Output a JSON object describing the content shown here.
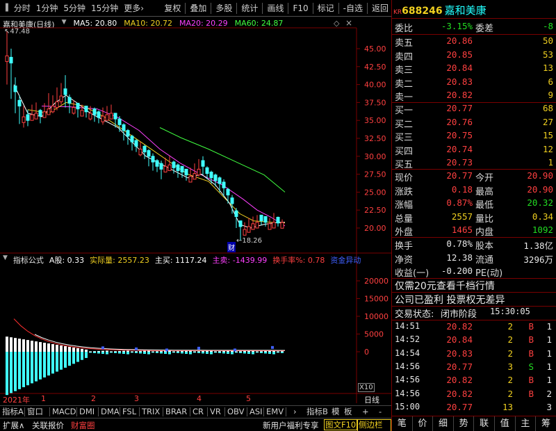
{
  "toolbar": {
    "left_items": [
      "分时",
      "1分钟",
      "5分钟",
      "15分钟",
      "更多"
    ],
    "more_arrow": "›",
    "right_items": [
      "复权",
      "叠加",
      "多股",
      "统计",
      "画线",
      "F10",
      "标记",
      "-自选",
      "返回"
    ]
  },
  "main_chart": {
    "title": "嘉和美康(日线)",
    "ma": [
      {
        "label": "MA5: 20.80",
        "color": "#ffffff"
      },
      {
        "label": "MA10: 20.72",
        "color": "#f0d020"
      },
      {
        "label": "MA20: 20.29",
        "color": "#ff40ff"
      },
      {
        "label": "MA60: 24.87",
        "color": "#40ff40"
      }
    ],
    "high_label": "47.48",
    "low_label": "18.26",
    "marker": "财",
    "y_ticks": [
      "45.00",
      "42.50",
      "40.00",
      "37.50",
      "35.00",
      "32.50",
      "30.00",
      "27.50",
      "25.00",
      "22.50",
      "20.00"
    ]
  },
  "chart_data": {
    "type": "candlestick",
    "ylim": [
      18,
      48
    ],
    "ma60_points": [
      [
        230,
        34.0
      ],
      [
        260,
        32.6
      ],
      [
        300,
        31.0
      ],
      [
        340,
        29.2
      ],
      [
        380,
        27.4
      ],
      [
        410,
        25.0
      ]
    ],
    "ma20_points": [
      [
        60,
        37.0
      ],
      [
        100,
        36.9
      ],
      [
        140,
        36.6
      ],
      [
        170,
        35.4
      ],
      [
        200,
        33.6
      ],
      [
        230,
        31.0
      ],
      [
        260,
        29.0
      ],
      [
        290,
        27.4
      ],
      [
        320,
        26.0
      ],
      [
        350,
        24.0
      ],
      [
        370,
        22.5
      ],
      [
        390,
        21.5
      ],
      [
        410,
        20.3
      ]
    ],
    "ma10_points": [
      [
        40,
        36.5
      ],
      [
        70,
        36.0
      ],
      [
        95,
        37.5
      ],
      [
        120,
        37.0
      ],
      [
        150,
        35.5
      ],
      [
        180,
        33.5
      ],
      [
        210,
        31.5
      ],
      [
        240,
        29.5
      ],
      [
        270,
        27.5
      ],
      [
        300,
        26.5
      ],
      [
        325,
        24.0
      ],
      [
        345,
        22.0
      ],
      [
        365,
        21.0
      ],
      [
        390,
        20.8
      ],
      [
        410,
        20.72
      ]
    ],
    "ma5_points": [
      [
        20,
        40.0
      ],
      [
        40,
        36.0
      ],
      [
        60,
        35.5
      ],
      [
        80,
        37.5
      ],
      [
        95,
        38.5
      ],
      [
        110,
        37.5
      ],
      [
        130,
        36.0
      ],
      [
        150,
        35.0
      ],
      [
        170,
        34.0
      ],
      [
        190,
        32.0
      ],
      [
        210,
        30.0
      ],
      [
        230,
        29.0
      ],
      [
        250,
        28.0
      ],
      [
        270,
        27.0
      ],
      [
        290,
        27.5
      ],
      [
        310,
        26.0
      ],
      [
        330,
        23.5
      ],
      [
        345,
        20.5
      ],
      [
        360,
        20.0
      ],
      [
        380,
        20.5
      ],
      [
        400,
        20.8
      ],
      [
        410,
        20.8
      ]
    ],
    "candles": [
      [
        10,
        44,
        47.48,
        40,
        "r"
      ],
      [
        16,
        43,
        45,
        38,
        "g"
      ],
      [
        22,
        39,
        41,
        36,
        "g"
      ],
      [
        28,
        37,
        38.5,
        34.5,
        "g"
      ],
      [
        34,
        35.5,
        37,
        34,
        "r"
      ],
      [
        40,
        35,
        36.5,
        34.2,
        "g"
      ],
      [
        46,
        35.8,
        37.2,
        35,
        "r"
      ],
      [
        52,
        36,
        37.5,
        35.2,
        "r"
      ],
      [
        58,
        35.6,
        36.6,
        34.6,
        "g"
      ],
      [
        64,
        36.2,
        37.4,
        35.4,
        "r"
      ],
      [
        70,
        36.6,
        38.8,
        35.8,
        "r"
      ],
      [
        76,
        37,
        38.5,
        36,
        "r"
      ],
      [
        82,
        37.6,
        39.6,
        36.4,
        "r"
      ],
      [
        88,
        38.4,
        40.2,
        37.2,
        "r"
      ],
      [
        94,
        38.6,
        41.3,
        36.8,
        "g"
      ],
      [
        100,
        37.4,
        38.6,
        36,
        "g"
      ],
      [
        106,
        36.8,
        37.8,
        35.8,
        "r"
      ],
      [
        112,
        36.6,
        37.4,
        35.4,
        "g"
      ],
      [
        118,
        36.4,
        37.2,
        35.6,
        "r"
      ],
      [
        124,
        36.2,
        37,
        35.4,
        "g"
      ],
      [
        130,
        36,
        37,
        35,
        "r"
      ],
      [
        136,
        35.8,
        36.8,
        34.8,
        "g"
      ],
      [
        142,
        35.4,
        36.4,
        34.6,
        "g"
      ],
      [
        148,
        35.6,
        36.8,
        34.4,
        "r"
      ],
      [
        154,
        35.8,
        37,
        35,
        "r"
      ],
      [
        160,
        36,
        37.2,
        35.2,
        "r"
      ],
      [
        166,
        35.2,
        36,
        34,
        "g"
      ],
      [
        172,
        34.4,
        35.6,
        33.4,
        "g"
      ],
      [
        178,
        33.6,
        34.6,
        32.2,
        "g"
      ],
      [
        184,
        32.8,
        33.8,
        31.6,
        "g"
      ],
      [
        190,
        32,
        33,
        30.8,
        "g"
      ],
      [
        196,
        31.4,
        32.4,
        30.6,
        "g"
      ],
      [
        202,
        31,
        32,
        30,
        "r"
      ],
      [
        208,
        30.6,
        31.6,
        29.6,
        "g"
      ],
      [
        214,
        30,
        31,
        28.6,
        "g"
      ],
      [
        220,
        29.2,
        30.4,
        28,
        "g"
      ],
      [
        226,
        28.6,
        29.6,
        27.8,
        "g"
      ],
      [
        232,
        28.2,
        29.4,
        26.8,
        "g"
      ],
      [
        238,
        28.6,
        29.8,
        27.8,
        "r"
      ],
      [
        244,
        28.8,
        30,
        28,
        "r"
      ],
      [
        250,
        28.4,
        29.4,
        27.6,
        "g"
      ],
      [
        256,
        28,
        29,
        27,
        "g"
      ],
      [
        262,
        27.8,
        28.6,
        27,
        "g"
      ],
      [
        268,
        27.4,
        28.2,
        26.6,
        "g"
      ],
      [
        274,
        27.2,
        28.4,
        26.4,
        "r"
      ],
      [
        280,
        27.6,
        29,
        26.8,
        "r"
      ],
      [
        286,
        28.2,
        29.6,
        27.2,
        "r"
      ],
      [
        292,
        28.6,
        30,
        27.4,
        "g"
      ],
      [
        298,
        27.6,
        28.6,
        26.8,
        "g"
      ],
      [
        304,
        27,
        28,
        26.2,
        "g"
      ],
      [
        310,
        26.6,
        27.6,
        25.8,
        "g"
      ],
      [
        316,
        26.2,
        27.2,
        25,
        "g"
      ],
      [
        322,
        25.6,
        26.8,
        24.4,
        "g"
      ],
      [
        328,
        24.6,
        25.6,
        23.4,
        "g"
      ],
      [
        334,
        23.4,
        24.6,
        22,
        "g"
      ],
      [
        340,
        21.6,
        22.8,
        20,
        "g"
      ],
      [
        346,
        20.2,
        21,
        18.26,
        "g"
      ],
      [
        352,
        19.8,
        20.8,
        19,
        "r"
      ],
      [
        358,
        20.2,
        21.4,
        19.6,
        "r"
      ],
      [
        364,
        20.6,
        21.6,
        20,
        "r"
      ],
      [
        370,
        20.8,
        21.8,
        20.2,
        "r"
      ],
      [
        376,
        21,
        21.8,
        20.4,
        "g"
      ],
      [
        382,
        20.8,
        21.6,
        20.2,
        "g"
      ],
      [
        388,
        20.6,
        21.4,
        20,
        "r"
      ],
      [
        394,
        20.8,
        22.1,
        20.2,
        "r"
      ],
      [
        400,
        20.7,
        21.6,
        20.2,
        "g"
      ],
      [
        406,
        20.77,
        21.2,
        20.3,
        "r"
      ]
    ]
  },
  "indicator": {
    "title": "指标公式",
    "items": [
      {
        "label": "A股: 0.33",
        "color": "#ffffff"
      },
      {
        "label": "实际量: 2557.23",
        "color": "#f0d020"
      },
      {
        "label": "主买: 1117.24",
        "color": "#ffffff"
      },
      {
        "label": "主卖: -1439.99",
        "color": "#ff40ff"
      },
      {
        "label": "换手率%: 0.78",
        "color": "#ff4040"
      },
      {
        "label": "资金异动",
        "color": "#4060ff"
      }
    ],
    "y_ticks": [
      "20000",
      "15000",
      "10000",
      "5000",
      "0"
    ],
    "x10": "X10"
  },
  "xaxis": {
    "year": "2021年",
    "months": [
      "1",
      "2",
      "3",
      "4",
      "5"
    ],
    "period": "日线"
  },
  "bottom_tabs": [
    "指标A",
    "窗口",
    "MACD",
    "DMI",
    "DMA",
    "FSL",
    "TRIX",
    "BRAR",
    "CR",
    "VR",
    "OBV",
    "ASI",
    "EMV"
  ],
  "bottom_tabs_arrow": "›",
  "bottom_tabs_right": [
    "指标B",
    "模",
    "板",
    "+",
    "-"
  ],
  "status_bar": {
    "left": [
      "扩展∧",
      "关联报价",
      "财富圈"
    ],
    "right": "新用户福利专享",
    "f10": "图文F10",
    "side": "侧边栏",
    "side_arrow": "≪"
  },
  "quote": {
    "kr": "KR",
    "code": "688246",
    "name": "嘉和美康",
    "weibi_label": "委比",
    "weibi": "-3.15%",
    "weicha_label": "委差",
    "weicha": "-8",
    "sell": [
      {
        "label": "卖五",
        "price": "20.86",
        "vol": "50"
      },
      {
        "label": "卖四",
        "price": "20.85",
        "vol": "53"
      },
      {
        "label": "卖三",
        "price": "20.84",
        "vol": "13"
      },
      {
        "label": "卖二",
        "price": "20.83",
        "vol": "6"
      },
      {
        "label": "卖一",
        "price": "20.82",
        "vol": "9"
      }
    ],
    "buy": [
      {
        "label": "买一",
        "price": "20.77",
        "vol": "68"
      },
      {
        "label": "买二",
        "price": "20.76",
        "vol": "27"
      },
      {
        "label": "买三",
        "price": "20.75",
        "vol": "15"
      },
      {
        "label": "买四",
        "price": "20.74",
        "vol": "12"
      },
      {
        "label": "买五",
        "price": "20.73",
        "vol": "1"
      }
    ],
    "stats": [
      {
        "l1": "现价",
        "v1": "20.77",
        "c1": "red",
        "l2": "今开",
        "v2": "20.90",
        "c2": "red"
      },
      {
        "l1": "涨跌",
        "v1": "0.18",
        "c1": "red",
        "l2": "最高",
        "v2": "20.90",
        "c2": "red"
      },
      {
        "l1": "涨幅",
        "v1": "0.87%",
        "c1": "red",
        "l2": "最低",
        "v2": "20.32",
        "c2": "green"
      },
      {
        "l1": "总量",
        "v1": "2557",
        "c1": "yellow",
        "l2": "量比",
        "v2": "0.34",
        "c2": "yellow"
      },
      {
        "l1": "外盘",
        "v1": "1465",
        "c1": "red",
        "l2": "内盘",
        "v2": "1092",
        "c2": "green"
      }
    ],
    "stats2": [
      {
        "l1": "换手",
        "v1": "0.78%",
        "l2": "股本",
        "v2": "1.38亿"
      },
      {
        "l1": "净资",
        "v1": "12.38",
        "l2": "流通",
        "v2": "3296万"
      },
      {
        "l1": "收益(一)",
        "v1": "-0.200",
        "l2": "PE(动)",
        "v2": ""
      }
    ],
    "promo1": "仅需20元查看千档行情",
    "promo2": "公司已盈利 投票权无差异",
    "status_label": "交易状态:",
    "status_value": "闭市阶段",
    "status_time": "15:30:05",
    "ticks": [
      {
        "time": "14:51",
        "price": "20.82",
        "vol": "2",
        "side": "B",
        "n": "1"
      },
      {
        "time": "14:52",
        "price": "20.84",
        "vol": "2",
        "side": "B",
        "n": "1"
      },
      {
        "time": "14:54",
        "price": "20.83",
        "vol": "2",
        "side": "B",
        "n": "1"
      },
      {
        "time": "14:56",
        "price": "20.77",
        "vol": "3",
        "side": "S",
        "n": "1"
      },
      {
        "time": "14:56",
        "price": "20.82",
        "vol": "2",
        "side": "B",
        "n": "1"
      },
      {
        "time": "14:56",
        "price": "20.82",
        "vol": "2",
        "side": "B",
        "n": "2"
      },
      {
        "time": "15:00",
        "price": "20.77",
        "vol": "13",
        "side": "",
        "n": "3"
      }
    ],
    "bottom_tabs": [
      "笔",
      "价",
      "细",
      "势",
      "联",
      "值",
      "主",
      "筹"
    ]
  }
}
